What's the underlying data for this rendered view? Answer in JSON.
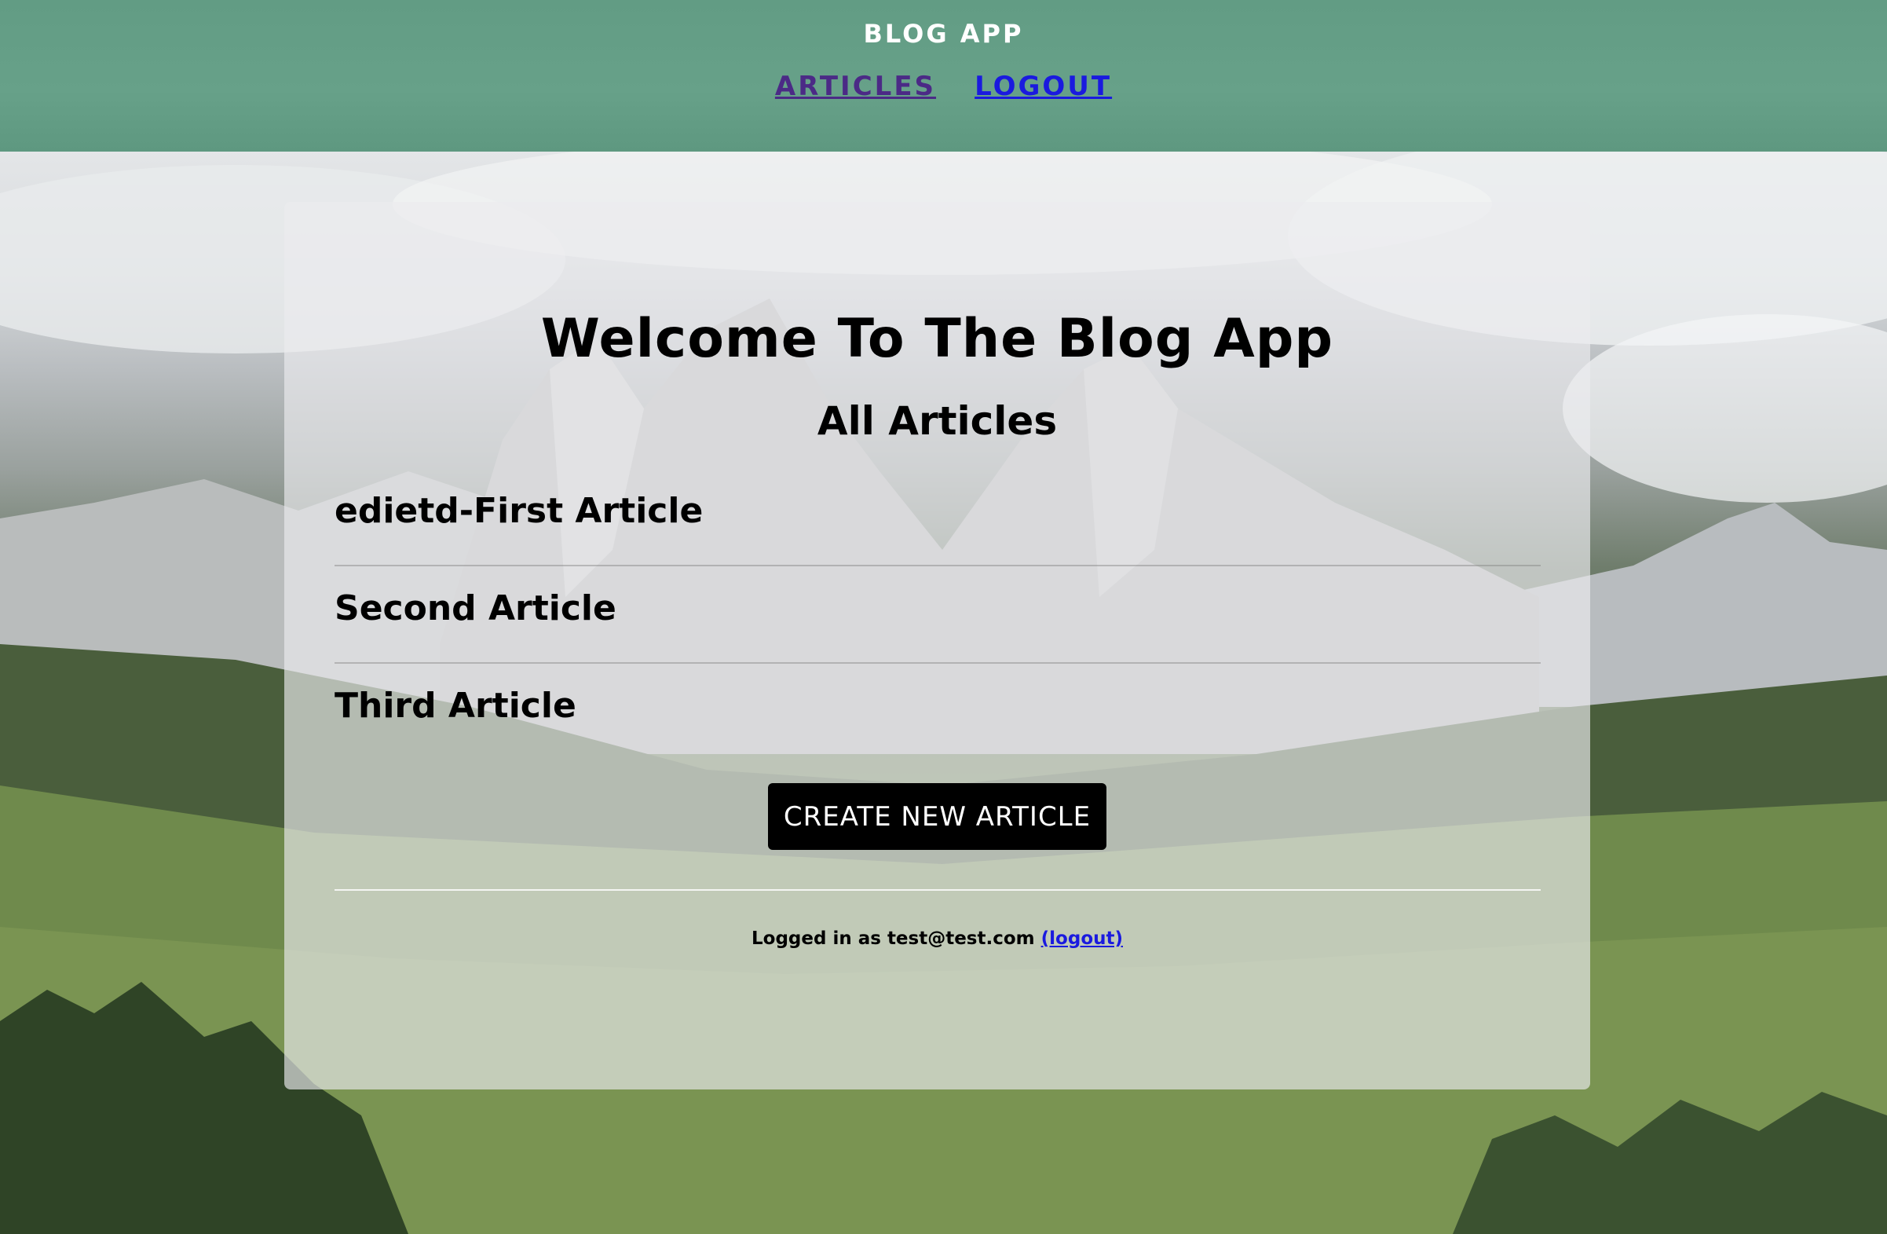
{
  "header": {
    "brand": "BLOG APP",
    "nav": [
      {
        "label": "ARTICLES"
      },
      {
        "label": "LOGOUT"
      }
    ]
  },
  "main": {
    "welcome_title": "Welcome To The Blog App",
    "section_title": "All Articles",
    "articles": [
      {
        "title": "edietd-First Article"
      },
      {
        "title": "Second Article"
      },
      {
        "title": "Third Article"
      }
    ],
    "create_button": "CREATE NEW ARTICLE",
    "footer_prefix": "Logged in as test@test.com",
    "footer_link": "(logout)"
  },
  "colors": {
    "header_bg": "#67a189",
    "visited_link": "#4b2a86",
    "link": "#1a1adf",
    "button_bg": "#000000"
  }
}
